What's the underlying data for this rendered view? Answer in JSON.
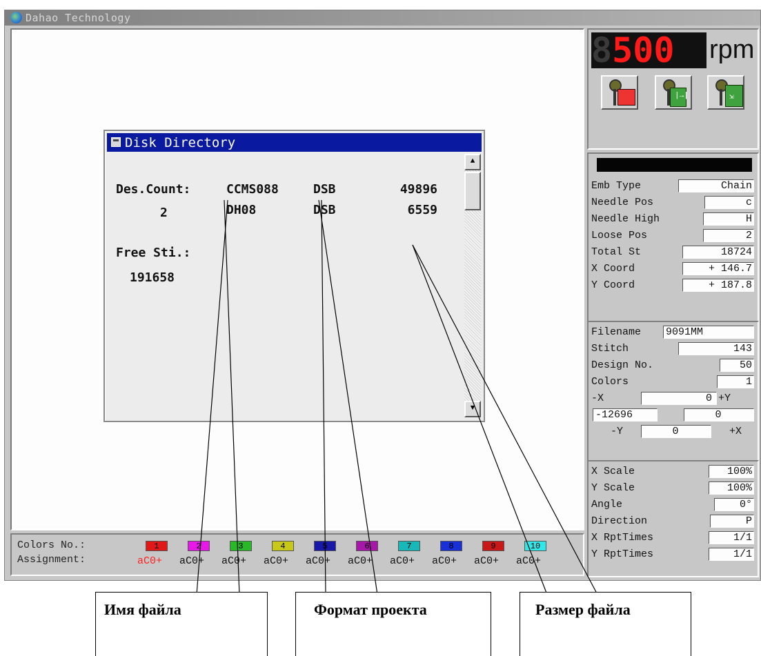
{
  "window": {
    "title": "Dahao Technology"
  },
  "dialog": {
    "title": "Disk Directory",
    "des_count_label": "Des.Count:",
    "des_count_value": "2",
    "free_label": "Free Sti.:",
    "free_value": "191658",
    "files": [
      {
        "name": "CCMS088",
        "format": "DSB",
        "size": "49896"
      },
      {
        "name": "DH08",
        "format": "DSB",
        "size": "6559"
      }
    ],
    "scroll_up": "▲",
    "scroll_down": "▼"
  },
  "colorbar": {
    "colors_label": "Colors No.:",
    "assignment_label": "Assignment:",
    "swatches": [
      {
        "num": "1",
        "color": "#e01818"
      },
      {
        "num": "2",
        "color": "#e818e8"
      },
      {
        "num": "3",
        "color": "#28b828"
      },
      {
        "num": "4",
        "color": "#c8c818"
      },
      {
        "num": "5",
        "color": "#1818a8"
      },
      {
        "num": "6",
        "color": "#a818a8"
      },
      {
        "num": "7",
        "color": "#18b8b8"
      },
      {
        "num": "8",
        "color": "#1830d8"
      },
      {
        "num": "9",
        "color": "#c81818"
      },
      {
        "num": "10",
        "color": "#30e8e8"
      }
    ],
    "assignments": [
      "aC0+",
      "aC0+",
      "aC0+",
      "aC0+",
      "aC0+",
      "aC0+",
      "aC0+",
      "aC0+",
      "aC0+",
      "aC0+"
    ],
    "first_assignment_color": "#ff2020"
  },
  "panel": {
    "speed": {
      "dim_digit": "8",
      "value": "500",
      "unit": "rpm"
    },
    "tools": [
      {
        "name": "stop-tool-icon"
      },
      {
        "name": "frame-tool-icon"
      },
      {
        "name": "frame-move-tool-icon"
      }
    ],
    "machine": {
      "emb_type_label": "Emb Type",
      "emb_type": "Chain",
      "needle_pos_label": "Needle Pos",
      "needle_pos": "c",
      "needle_high_label": "Needle High",
      "needle_high": "H",
      "loose_pos_label": "Loose Pos",
      "loose_pos": "2",
      "total_st_label": "Total St",
      "total_st": "18724",
      "x_coord_label": "X Coord",
      "x_coord": "+ 146.7",
      "y_coord_label": "Y Coord",
      "y_coord": "+ 187.8"
    },
    "design": {
      "filename_label": "Filename",
      "filename": "9091MM",
      "stitch_label": "Stitch",
      "stitch": "143",
      "design_no_label": "Design No.",
      "design_no": "50",
      "colors_label": "Colors",
      "colors": "1",
      "minus_x_label": "-X",
      "minus_x": "0",
      "plus_y_label": "+Y",
      "minus_y_value": "-12696",
      "plus_y_value": "0",
      "minus_y_label": "-Y",
      "minus_y_bottom": "0",
      "plus_x_label": "+X"
    },
    "scale": {
      "x_scale_label": "X Scale",
      "x_scale": "100%",
      "y_scale_label": "Y Scale",
      "y_scale": "100%",
      "angle_label": "Angle",
      "angle": "0°",
      "direction_label": "Direction",
      "direction": "P",
      "x_rpt_label": "X RptTimes",
      "x_rpt": "1/1",
      "y_rpt_label": "Y RptTimes",
      "y_rpt": "1/1"
    }
  },
  "callouts": {
    "file_name": "Имя файла",
    "project_format": "Формат проекта",
    "file_size": "Размер файла"
  }
}
